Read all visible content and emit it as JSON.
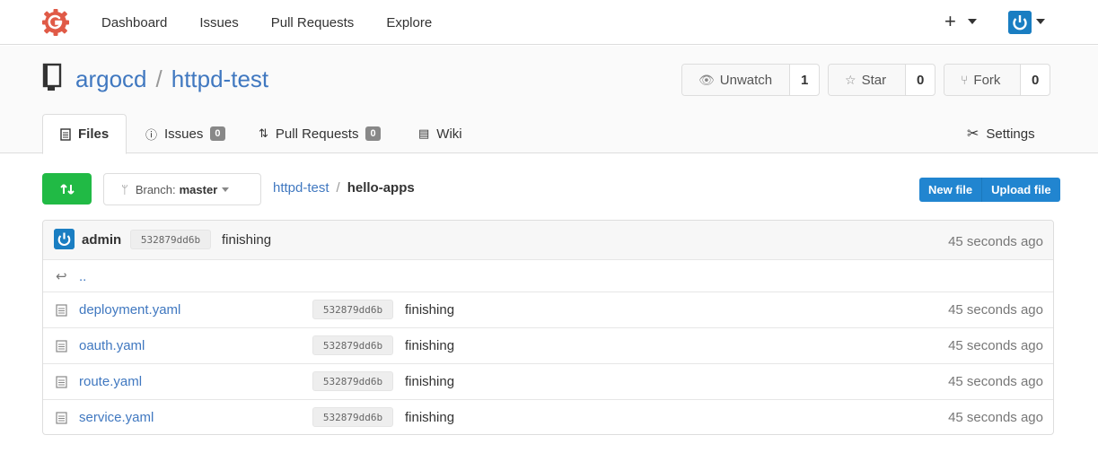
{
  "nav": {
    "items": [
      "Dashboard",
      "Issues",
      "Pull Requests",
      "Explore"
    ],
    "plus_icon": "plus-icon",
    "colors": {
      "logo": "#e05a47",
      "avatar": "#1a7ec2"
    }
  },
  "repo": {
    "owner": "argocd",
    "name": "httpd-test",
    "watch": {
      "label": "Unwatch",
      "count": "1"
    },
    "star": {
      "label": "Star",
      "count": "0"
    },
    "fork": {
      "label": "Fork",
      "count": "0"
    }
  },
  "tabs": {
    "files": "Files",
    "issues": {
      "label": "Issues",
      "count": "0"
    },
    "pulls": {
      "label": "Pull Requests",
      "count": "0"
    },
    "wiki": "Wiki",
    "settings": "Settings"
  },
  "toolbar": {
    "branch_prefix": "Branch:",
    "branch_name": "master",
    "breadcrumb_repo": "httpd-test",
    "breadcrumb_current": "hello-apps",
    "new_file": "New file",
    "upload_file": "Upload file",
    "accent_green": "#21ba45",
    "accent_blue": "#2185d0"
  },
  "latest_commit": {
    "user": "admin",
    "sha": "532879dd6b",
    "message": "finishing",
    "age": "45 seconds ago"
  },
  "parent_dir": "..",
  "files": [
    {
      "name": "deployment.yaml",
      "sha": "532879dd6b",
      "message": "finishing",
      "age": "45 seconds ago"
    },
    {
      "name": "oauth.yaml",
      "sha": "532879dd6b",
      "message": "finishing",
      "age": "45 seconds ago"
    },
    {
      "name": "route.yaml",
      "sha": "532879dd6b",
      "message": "finishing",
      "age": "45 seconds ago"
    },
    {
      "name": "service.yaml",
      "sha": "532879dd6b",
      "message": "finishing",
      "age": "45 seconds ago"
    }
  ]
}
